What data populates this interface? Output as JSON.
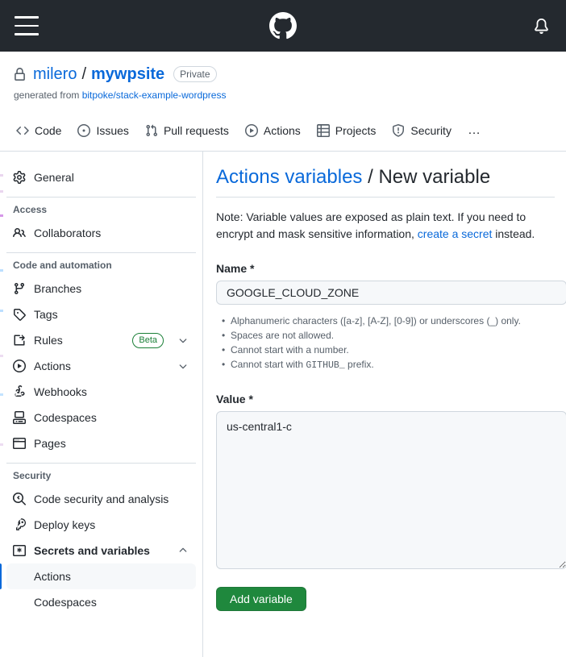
{
  "topbar": {
    "menu_icon": "hamburger-icon",
    "logo_icon": "github-logo-icon",
    "notifications_icon": "bell-icon"
  },
  "repo": {
    "visibility_icon": "lock-icon",
    "owner": "milero",
    "separator": "/",
    "name": "mywpsite",
    "visibility": "Private",
    "generated_prefix": "generated from ",
    "template_repo": "bitpoke/stack-example-wordpress"
  },
  "repo_nav": {
    "items": [
      {
        "label": "Code",
        "icon": "code-icon"
      },
      {
        "label": "Issues",
        "icon": "issue-opened-icon"
      },
      {
        "label": "Pull requests",
        "icon": "git-pull-request-icon"
      },
      {
        "label": "Actions",
        "icon": "play-icon"
      },
      {
        "label": "Projects",
        "icon": "table-icon"
      },
      {
        "label": "Security",
        "icon": "shield-icon"
      }
    ],
    "overflow_label": "…"
  },
  "sidebar": {
    "general": {
      "label": "General",
      "icon": "gear-icon"
    },
    "sections": [
      {
        "title": "Access",
        "items": [
          {
            "label": "Collaborators",
            "icon": "people-icon"
          }
        ]
      },
      {
        "title": "Code and automation",
        "items": [
          {
            "label": "Branches",
            "icon": "git-branch-icon"
          },
          {
            "label": "Tags",
            "icon": "tag-icon"
          },
          {
            "label": "Rules",
            "icon": "rules-icon",
            "badge": "Beta",
            "chevron": "chevron-down-icon"
          },
          {
            "label": "Actions",
            "icon": "play-icon",
            "chevron": "chevron-down-icon"
          },
          {
            "label": "Webhooks",
            "icon": "webhook-icon"
          },
          {
            "label": "Codespaces",
            "icon": "codespaces-icon"
          },
          {
            "label": "Pages",
            "icon": "browser-icon"
          }
        ]
      },
      {
        "title": "Security",
        "items": [
          {
            "label": "Code security and analysis",
            "icon": "codescan-icon"
          },
          {
            "label": "Deploy keys",
            "icon": "key-icon"
          },
          {
            "label": "Secrets and variables",
            "icon": "asterisk-key-icon",
            "bold": true,
            "chevron": "chevron-up-icon"
          },
          {
            "label": "Actions",
            "sub": true,
            "active": true
          },
          {
            "label": "Codespaces",
            "sub": true
          }
        ]
      }
    ]
  },
  "main": {
    "heading_link": "Actions variables",
    "heading_sep": " / ",
    "heading_current": "New variable",
    "note_part1": "Note: Variable values are exposed as plain text. If you need to encrypt and mask sensitive information, ",
    "note_link": "create a secret",
    "note_part2": " instead.",
    "name_label": "Name *",
    "name_value": "GOOGLE_CLOUD_ZONE",
    "name_placeholder": "",
    "hints": [
      {
        "text": "Alphanumeric characters ([a-z], [A-Z], [0-9]) or underscores (_) only."
      },
      {
        "text": "Spaces are not allowed."
      },
      {
        "text": "Cannot start with a number."
      },
      {
        "pre": "Cannot start with ",
        "mono": "GITHUB_",
        "post": " prefix."
      }
    ],
    "value_label": "Value *",
    "value_value": "us-central1-c",
    "value_placeholder": "",
    "submit_label": "Add variable"
  },
  "colors": {
    "header_bg": "#24292f",
    "link": "#0969da",
    "accent_green": "#1f883d",
    "beta_green": "#1a7f37",
    "muted": "#57606a",
    "border": "#d8dee4",
    "input_bg": "#f6f8fa",
    "active_indicator": "#0969da"
  }
}
